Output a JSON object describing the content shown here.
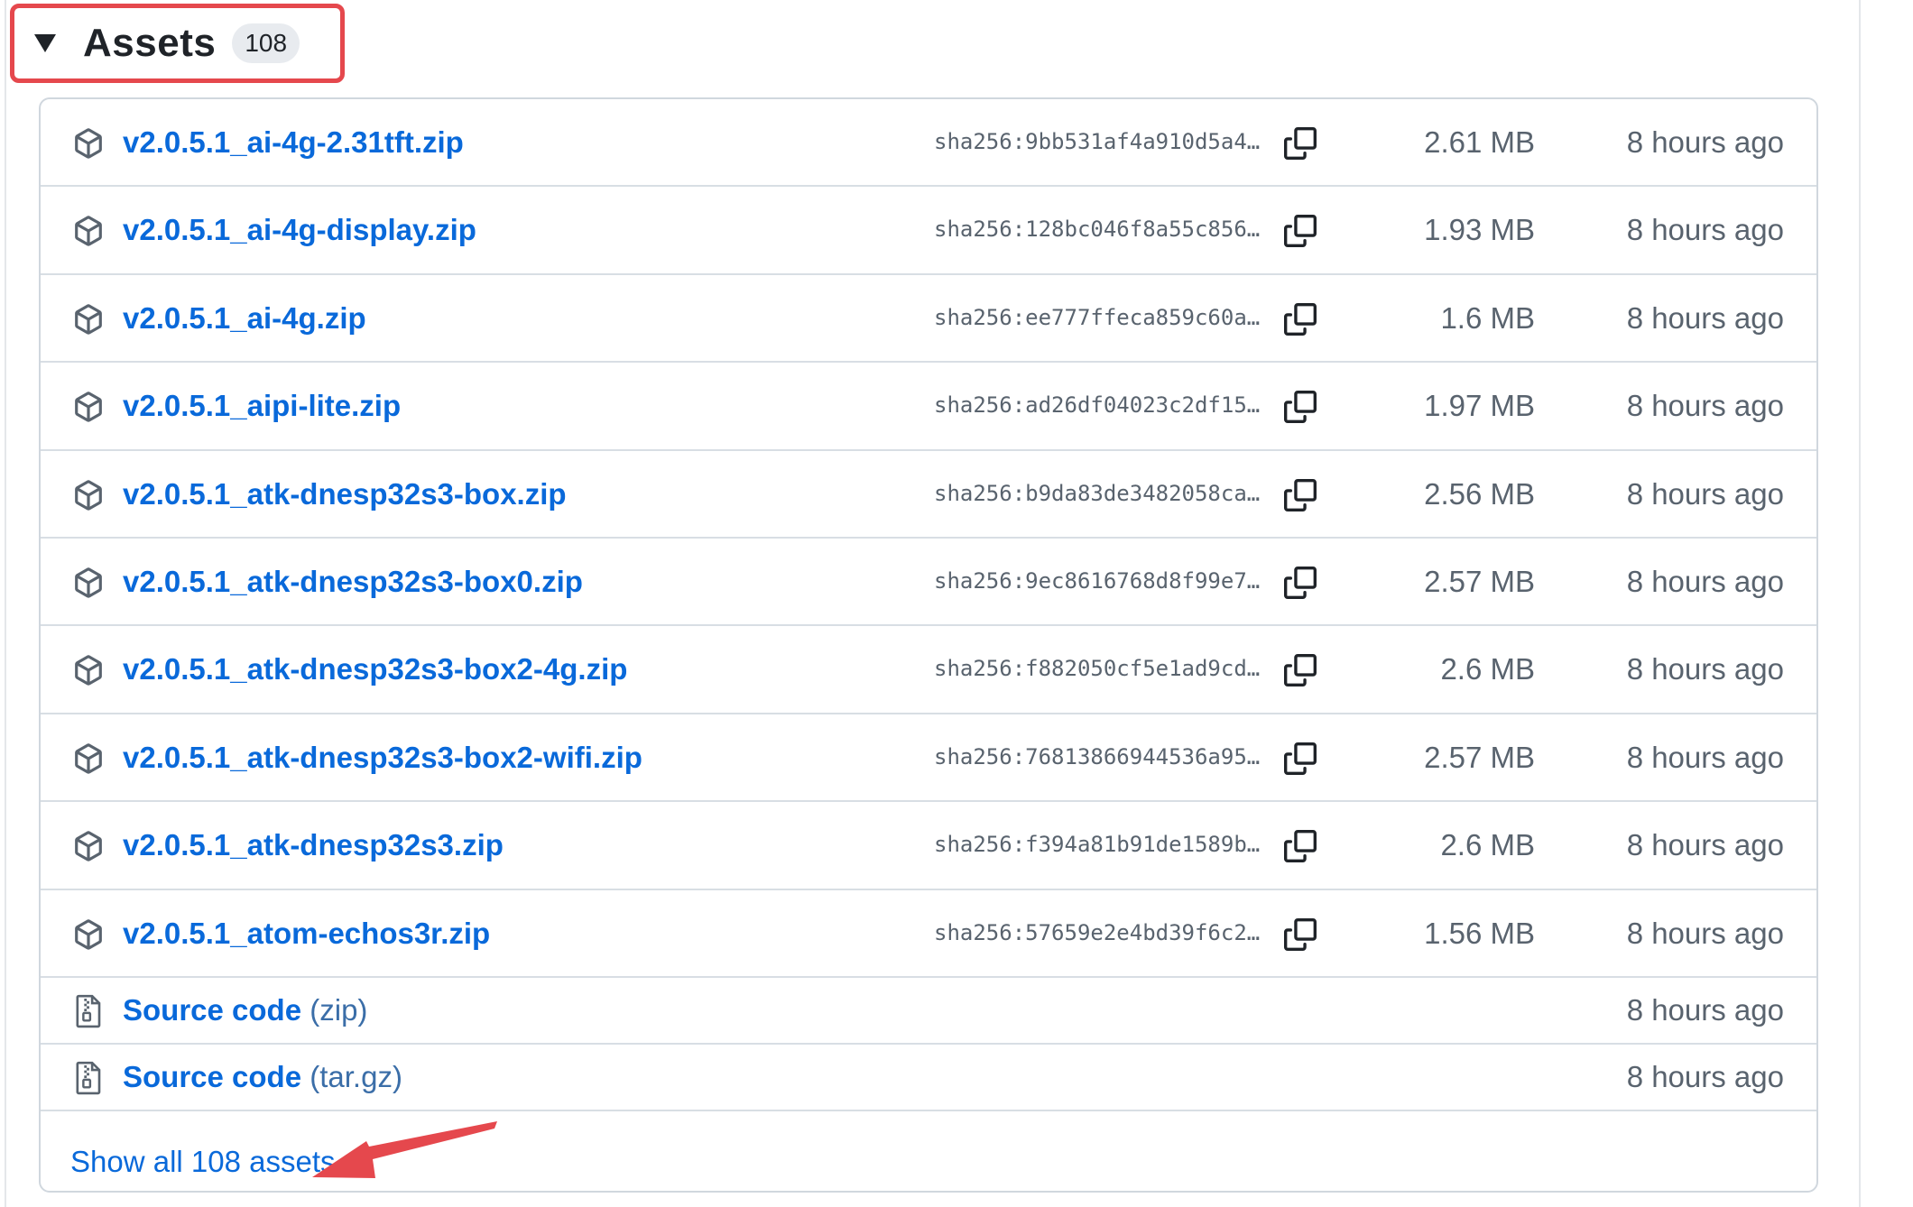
{
  "section": {
    "title": "Assets",
    "count": "108"
  },
  "assets": [
    {
      "name": "v2.0.5.1_ai-4g-2.31tft.zip",
      "sha": "sha256:9bb531af4a910d5a4…",
      "size": "2.61 MB",
      "time": "8 hours ago"
    },
    {
      "name": "v2.0.5.1_ai-4g-display.zip",
      "sha": "sha256:128bc046f8a55c856…",
      "size": "1.93 MB",
      "time": "8 hours ago"
    },
    {
      "name": "v2.0.5.1_ai-4g.zip",
      "sha": "sha256:ee777ffeca859c60a…",
      "size": "1.6 MB",
      "time": "8 hours ago"
    },
    {
      "name": "v2.0.5.1_aipi-lite.zip",
      "sha": "sha256:ad26df04023c2df15…",
      "size": "1.97 MB",
      "time": "8 hours ago"
    },
    {
      "name": "v2.0.5.1_atk-dnesp32s3-box.zip",
      "sha": "sha256:b9da83de3482058ca…",
      "size": "2.56 MB",
      "time": "8 hours ago"
    },
    {
      "name": "v2.0.5.1_atk-dnesp32s3-box0.zip",
      "sha": "sha256:9ec8616768d8f99e7…",
      "size": "2.57 MB",
      "time": "8 hours ago"
    },
    {
      "name": "v2.0.5.1_atk-dnesp32s3-box2-4g.zip",
      "sha": "sha256:f882050cf5e1ad9cd…",
      "size": "2.6 MB",
      "time": "8 hours ago"
    },
    {
      "name": "v2.0.5.1_atk-dnesp32s3-box2-wifi.zip",
      "sha": "sha256:76813866944536a95…",
      "size": "2.57 MB",
      "time": "8 hours ago"
    },
    {
      "name": "v2.0.5.1_atk-dnesp32s3.zip",
      "sha": "sha256:f394a81b91de1589b…",
      "size": "2.6 MB",
      "time": "8 hours ago"
    },
    {
      "name": "v2.0.5.1_atom-echos3r.zip",
      "sha": "sha256:57659e2e4bd39f6c2…",
      "size": "1.56 MB",
      "time": "8 hours ago"
    }
  ],
  "source_code": [
    {
      "label": "Source code",
      "ext": "(zip)",
      "time": "8 hours ago"
    },
    {
      "label": "Source code",
      "ext": "(tar.gz)",
      "time": "8 hours ago"
    }
  ],
  "show_all": "Show all 108 assets",
  "icons": {
    "asset": "package-icon",
    "source": "file-zip-icon",
    "copy": "copy-icon"
  },
  "colors": {
    "link": "#0969da",
    "muted": "#59636e",
    "highlight": "#e5484d",
    "border": "#d0d7de"
  }
}
